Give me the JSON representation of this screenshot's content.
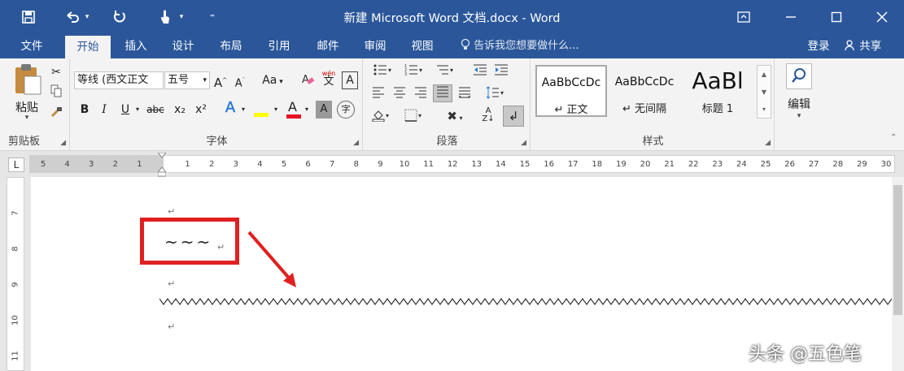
{
  "title_bar": {
    "title": "新建 Microsoft Word 文档.docx - Word",
    "icons": [
      "save-icon",
      "undo-icon",
      "redo-icon",
      "touch-mode-icon",
      "customize-icon",
      "ribbon-display-icon",
      "minimize-icon",
      "maximize-icon",
      "close-icon"
    ],
    "accent": "#2b579a"
  },
  "tabs": [
    "文件",
    "开始",
    "插入",
    "设计",
    "布局",
    "引用",
    "邮件",
    "审阅",
    "视图"
  ],
  "active_tab": "开始",
  "tell_me": "告诉我您想要做什么...",
  "login": "登录",
  "share": "共享",
  "clipboard": {
    "paste": "粘贴",
    "label": "剪贴板"
  },
  "font": {
    "name": "等线 (西文正文",
    "size": "五号",
    "label": "字体",
    "aa": "Aa",
    "wen": "wén",
    "bold": "B",
    "italic": "I",
    "underline": "U",
    "strike": "abc",
    "sub": "x₂",
    "sup": "x²",
    "color_a": "A",
    "highlight": "ab",
    "char_a": "A",
    "circle": "字",
    "font_color": "#e81123",
    "highlight_color": "#ffff00"
  },
  "paragraph": {
    "label": "段落"
  },
  "styles": {
    "label": "样式",
    "items": [
      {
        "sample": "AaBbCcDc",
        "name": "↵ 正文"
      },
      {
        "sample": "AaBbCcDc",
        "name": "↵ 无间隔"
      },
      {
        "sample": "AaBl",
        "name": "标题 1"
      }
    ]
  },
  "editing": {
    "label": "编辑"
  },
  "ruler": {
    "h_left": [
      "5",
      "4",
      "3",
      "2",
      "1"
    ],
    "h_right": [
      "1",
      "2",
      "3",
      "4",
      "5",
      "6",
      "7",
      "8",
      "9",
      "10",
      "11",
      "12",
      "13",
      "14",
      "15",
      "16",
      "17",
      "18",
      "19",
      "20",
      "21",
      "22",
      "23",
      "24",
      "25",
      "26",
      "27",
      "28",
      "29",
      "30"
    ],
    "v": [
      "7",
      "8",
      "9",
      "10",
      "11"
    ],
    "tab_marker": "L"
  },
  "document": {
    "tilde_text": "~~~",
    "para_mark": "↵",
    "annotation_color": "#e02020"
  },
  "watermark": "头条 @五色笔"
}
